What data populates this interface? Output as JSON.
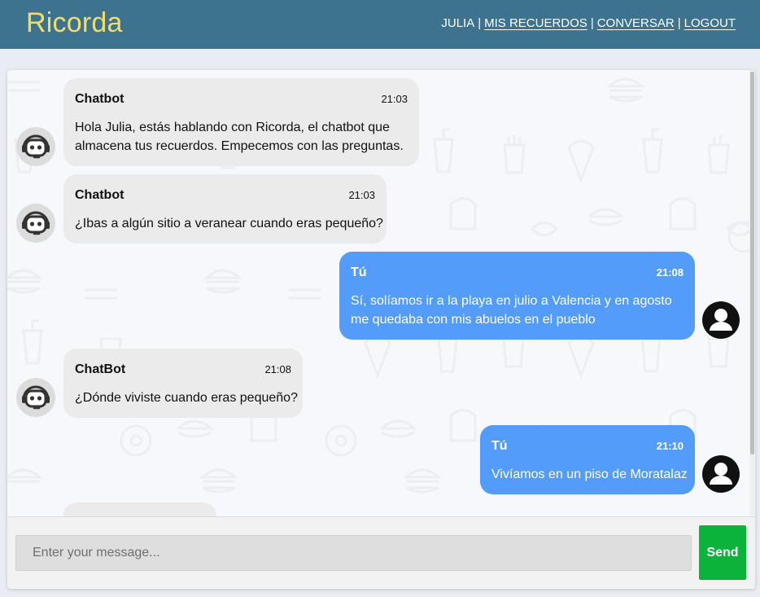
{
  "header": {
    "brand": "Ricorda",
    "nav": {
      "user": "JULIA",
      "mis_recuerdos": "MIS RECUERDOS",
      "conversar": "CONVERSAR",
      "logout": "LOGOUT",
      "separator": "|"
    }
  },
  "messages": [
    {
      "author": "Chatbot",
      "time": "21:03",
      "line1": "Hola Julia, estás hablando con Ricorda, el chatbot que",
      "line2": "almacena tus recuerdos. Empecemos con las preguntas."
    },
    {
      "author": "Chatbot",
      "time": "21:03",
      "line1": "¿Ibas a algún sitio a veranear cuando eras pequeño?"
    },
    {
      "author": "Tú",
      "time": "21:08",
      "line1": "Sí, solíamos ir a la playa en julio a Valencia y en agosto",
      "line2": "me quedaba con mis abuelos en el pueblo"
    },
    {
      "author": "ChatBot",
      "time": "21:08",
      "line1": "¿Dónde viviste cuando eras pequeño?"
    },
    {
      "author": "Tú",
      "time": "21:10",
      "line1": "Vivíamos en un piso de Moratalaz"
    }
  ],
  "composer": {
    "placeholder": "Enter your message...",
    "send_label": "Send"
  },
  "colors": {
    "header_bg": "#3e738f",
    "brand": "#f4dc6a",
    "bot_bubble": "#ebebeb",
    "user_bubble": "#549cf9",
    "send_button": "#0bb33a"
  },
  "icons": {
    "bot_avatar": "robot-icon",
    "user_avatar": "user-icon"
  }
}
